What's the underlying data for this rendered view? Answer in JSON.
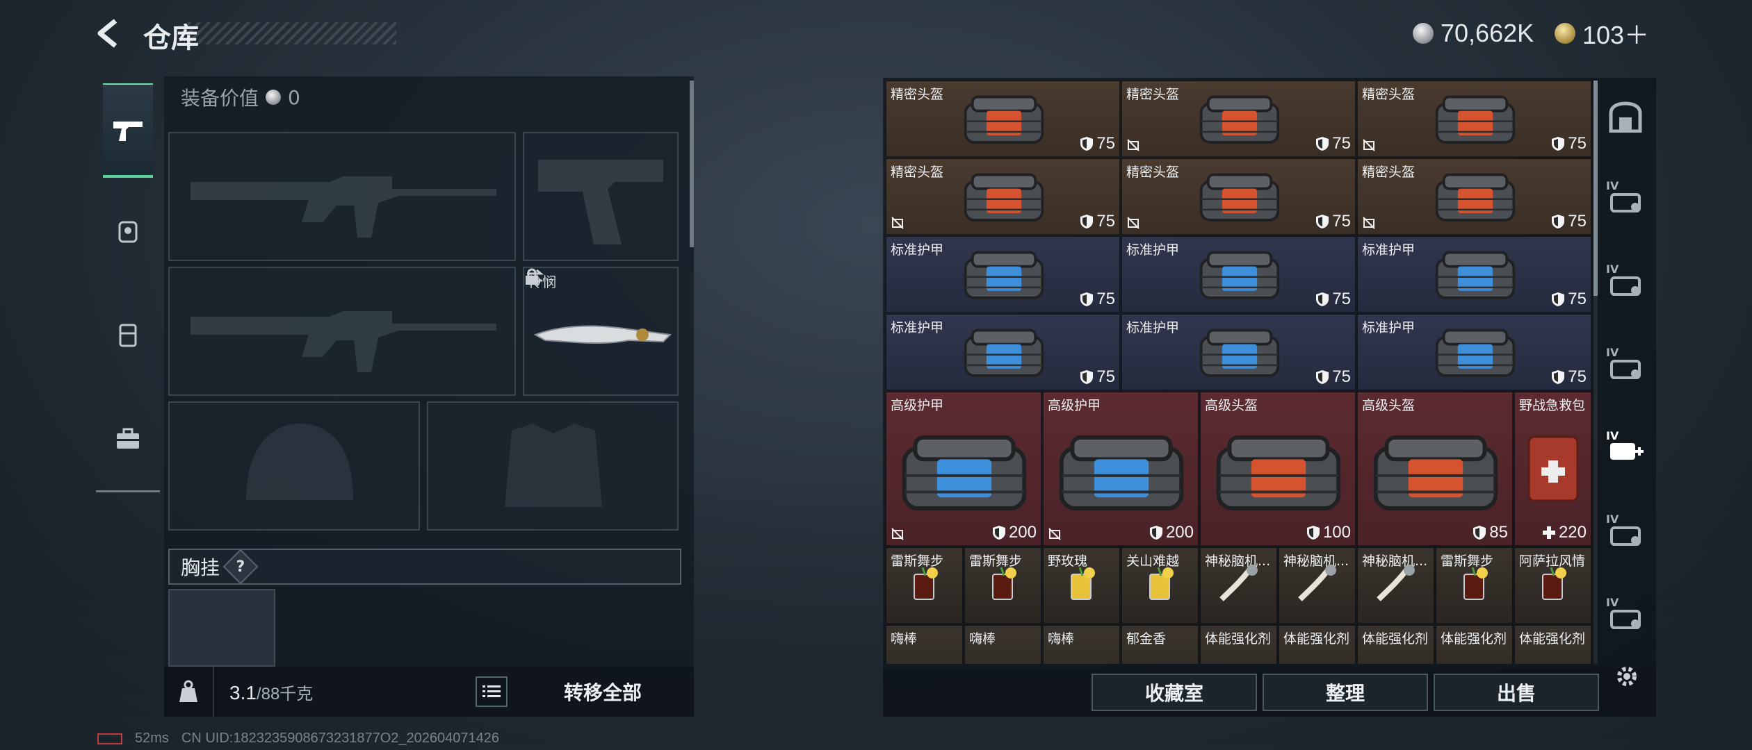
{
  "header": {
    "title": "仓库",
    "silver": "70,662K",
    "gold": "103＋"
  },
  "loadout": {
    "equip_value_label": "装备价值",
    "equip_value": "0",
    "melee_name": "怜悯",
    "chest_label": "胸挂",
    "help": "?"
  },
  "footer_left": {
    "weight": "3.1",
    "capacity": "/88千克",
    "transfer_all": "转移全部"
  },
  "stash": {
    "rows": [
      [
        {
          "name": "精密头盔",
          "val": "75",
          "kind": "helmet",
          "color": "brown",
          "nosell": false
        },
        {
          "name": "精密头盔",
          "val": "75",
          "kind": "helmet",
          "color": "brown",
          "nosell": true
        },
        {
          "name": "精密头盔",
          "val": "75",
          "kind": "helmet",
          "color": "brown",
          "nosell": true
        }
      ],
      [
        {
          "name": "精密头盔",
          "val": "75",
          "kind": "helmet",
          "color": "brown",
          "nosell": true
        },
        {
          "name": "精密头盔",
          "val": "75",
          "kind": "helmet",
          "color": "brown",
          "nosell": true
        },
        {
          "name": "精密头盔",
          "val": "75",
          "kind": "helmet",
          "color": "brown",
          "nosell": true
        }
      ],
      [
        {
          "name": "标准护甲",
          "val": "75",
          "kind": "armor",
          "color": "navy",
          "nosell": false
        },
        {
          "name": "标准护甲",
          "val": "75",
          "kind": "armor",
          "color": "navy",
          "nosell": false
        },
        {
          "name": "标准护甲",
          "val": "75",
          "kind": "armor",
          "color": "navy",
          "nosell": false
        }
      ],
      [
        {
          "name": "标准护甲",
          "val": "75",
          "kind": "armor",
          "color": "navy",
          "nosell": false
        },
        {
          "name": "标准护甲",
          "val": "75",
          "kind": "armor",
          "color": "navy",
          "nosell": false
        },
        {
          "name": "标准护甲",
          "val": "75",
          "kind": "armor",
          "color": "navy",
          "nosell": false
        }
      ]
    ],
    "big": [
      {
        "name": "高级护甲",
        "val": "200",
        "kind": "armor",
        "nosell": true
      },
      {
        "name": "高级护甲",
        "val": "200",
        "kind": "armor",
        "nosell": true
      },
      {
        "name": "高级头盔",
        "val": "100",
        "kind": "helmet",
        "nosell": false
      },
      {
        "name": "高级头盔",
        "val": "85",
        "kind": "helmet",
        "nosell": false
      }
    ],
    "medkit": {
      "name": "野战急救包",
      "val": "220"
    },
    "consumables": [
      {
        "name": "雷斯舞步",
        "kind": "cola"
      },
      {
        "name": "雷斯舞步",
        "kind": "cola"
      },
      {
        "name": "野玫瑰",
        "kind": "lemon"
      },
      {
        "name": "关山难越",
        "kind": "lemon"
      },
      {
        "name": "神秘脑机...",
        "kind": "syringe"
      },
      {
        "name": "神秘脑机...",
        "kind": "syringe"
      },
      {
        "name": "神秘脑机...",
        "kind": "syringe"
      },
      {
        "name": "雷斯舞步",
        "kind": "cola"
      },
      {
        "name": "阿萨拉风情",
        "kind": "cola"
      }
    ],
    "partial": [
      "嗨棒",
      "嗨棒",
      "嗨棒",
      "郁金香",
      "体能强化剂",
      "体能强化剂",
      "体能强化剂",
      "体能强化剂",
      "体能强化剂"
    ]
  },
  "actions": {
    "collection": "收藏室",
    "sort": "整理",
    "sell": "出售"
  },
  "rail": [
    "IV",
    "IV",
    "IV",
    "IV",
    "IV",
    "IV"
  ],
  "status": {
    "ping": "52ms",
    "uid": "CN UID:1823235908673231877O2_202604071426"
  }
}
